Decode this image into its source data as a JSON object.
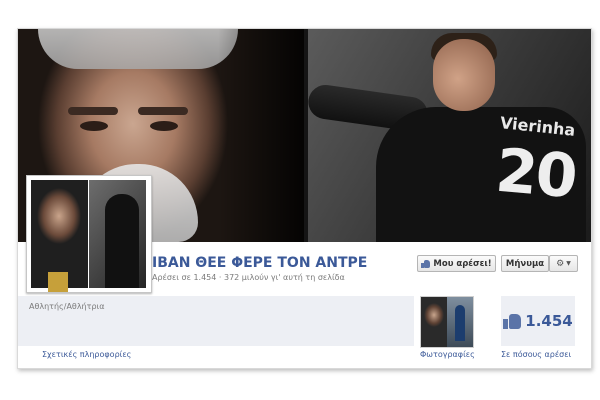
{
  "page": {
    "name": "ΙΒΑΝ ΘΕΕ ΦΕΡΕ ΤΟΝ ΑΝΤΡΕ",
    "likes_summary": "Αρέσει σε 1.454 · 372 μιλούν γι' αυτή τη σελίδα",
    "category": "Αθλητής/Αθλήτρια"
  },
  "cover": {
    "jersey_name": "Vierinha",
    "jersey_number": "20"
  },
  "actions": {
    "like_label": "Μου αρέσει!",
    "message_label": "Μήνυμα",
    "gear_icon": "gear-icon"
  },
  "apps": {
    "info_label": "Σχετικές πληροφορίες",
    "photos_label": "Φωτογραφίες",
    "likes_label": "Σε πόσους αρέσει",
    "like_count": "1.454"
  },
  "colors": {
    "link": "#3b5998",
    "panel": "#edeff4"
  }
}
